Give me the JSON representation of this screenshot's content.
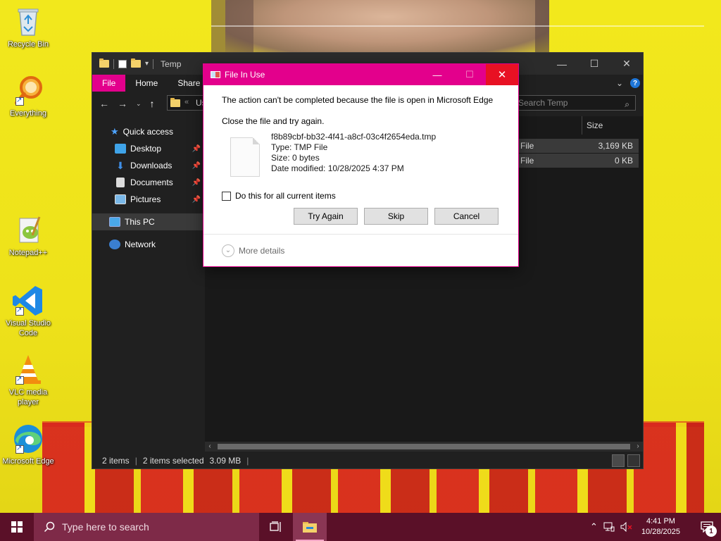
{
  "desktop": {
    "icons": [
      {
        "label": "Recycle Bin"
      },
      {
        "label": "Everything"
      },
      {
        "label": "Notepad++"
      },
      {
        "label": "Visual Studio Code"
      },
      {
        "label": "VLC media player"
      },
      {
        "label": "Microsoft Edge"
      }
    ]
  },
  "explorer": {
    "title": "Temp",
    "ribbon_tabs": [
      "File",
      "Home",
      "Share"
    ],
    "address_fragment": "Us",
    "search_placeholder": "Search Temp",
    "sidebar": [
      {
        "label": "Quick access"
      },
      {
        "label": "Desktop"
      },
      {
        "label": "Downloads"
      },
      {
        "label": "Documents"
      },
      {
        "label": "Pictures"
      },
      {
        "label": "This PC"
      },
      {
        "label": "Network"
      }
    ],
    "columns": {
      "size": "Size"
    },
    "rows": [
      {
        "type_fragment": "File",
        "size": "3,169 KB"
      },
      {
        "type_fragment": "File",
        "size": "0 KB"
      }
    ],
    "status": {
      "items": "2 items",
      "selected": "2 items selected",
      "size": "3.09 MB"
    }
  },
  "dialog": {
    "title": "File In Use",
    "message": "The action can't be completed because the file is open in Microsoft Edge",
    "instruction": "Close the file and try again.",
    "file": {
      "name": "f8b89cbf-bb32-4f41-a8cf-03c4f2654eda.tmp",
      "type": "Type: TMP File",
      "size": "Size: 0 bytes",
      "modified": "Date modified: 10/28/2025 4:37 PM"
    },
    "checkbox_label": "Do this for all current items",
    "buttons": {
      "try_again": "Try Again",
      "skip": "Skip",
      "cancel": "Cancel"
    },
    "more_details": "More details"
  },
  "taskbar": {
    "search_placeholder": "Type here to search",
    "time": "4:41 PM",
    "date": "10/28/2025",
    "notification_count": "1"
  },
  "colors": {
    "accent": "#e3008c",
    "taskbar": "#5a1028"
  }
}
